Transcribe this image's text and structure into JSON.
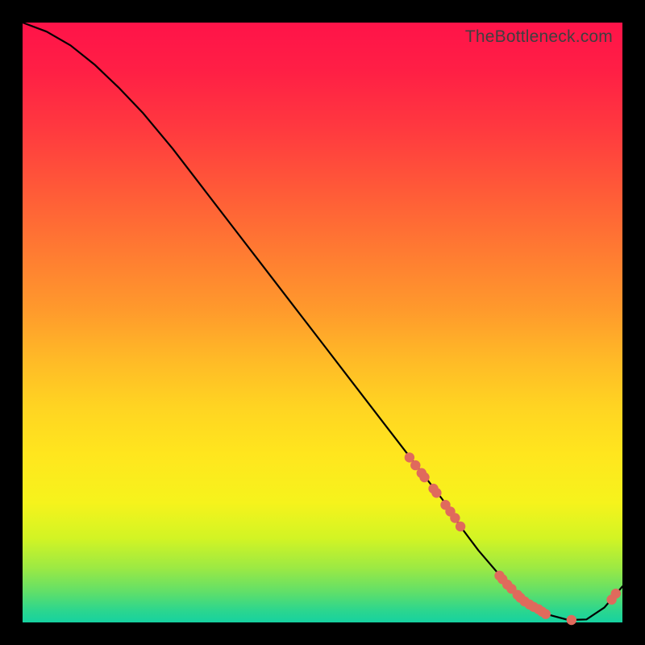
{
  "watermark": "TheBottleneck.com",
  "colors": {
    "dot": "#e06a5c",
    "curve": "#000000"
  },
  "chart_data": {
    "type": "line",
    "title": "",
    "xlabel": "",
    "ylabel": "",
    "xlim": [
      0,
      100
    ],
    "ylim": [
      0,
      100
    ],
    "x": [
      0,
      4,
      8,
      12,
      16,
      20,
      25,
      30,
      35,
      40,
      45,
      50,
      55,
      60,
      65,
      70,
      73,
      76,
      79,
      82,
      85,
      88,
      91,
      94,
      97,
      100
    ],
    "values": [
      100,
      98.5,
      96.2,
      93.0,
      89.2,
      85.0,
      79.0,
      72.5,
      66.0,
      59.5,
      53.0,
      46.5,
      40.0,
      33.5,
      27.0,
      20.5,
      16.0,
      12.0,
      8.5,
      5.3,
      2.8,
      1.2,
      0.4,
      0.5,
      2.5,
      6.0
    ],
    "markers_x": [
      64.5,
      65.5,
      66.5,
      67.0,
      68.5,
      69.0,
      70.5,
      71.3,
      72.1,
      73.0,
      79.5,
      80.0,
      80.8,
      81.5,
      82.5,
      83.0,
      83.7,
      84.5,
      85.2,
      86.0,
      86.6,
      87.2,
      91.5,
      98.2,
      98.9
    ],
    "markers_y": [
      27.5,
      26.2,
      24.9,
      24.2,
      22.3,
      21.6,
      19.6,
      18.5,
      17.4,
      16.0,
      7.8,
      7.2,
      6.3,
      5.6,
      4.6,
      4.1,
      3.5,
      3.0,
      2.6,
      2.2,
      1.8,
      1.4,
      0.4,
      3.8,
      4.8
    ]
  }
}
